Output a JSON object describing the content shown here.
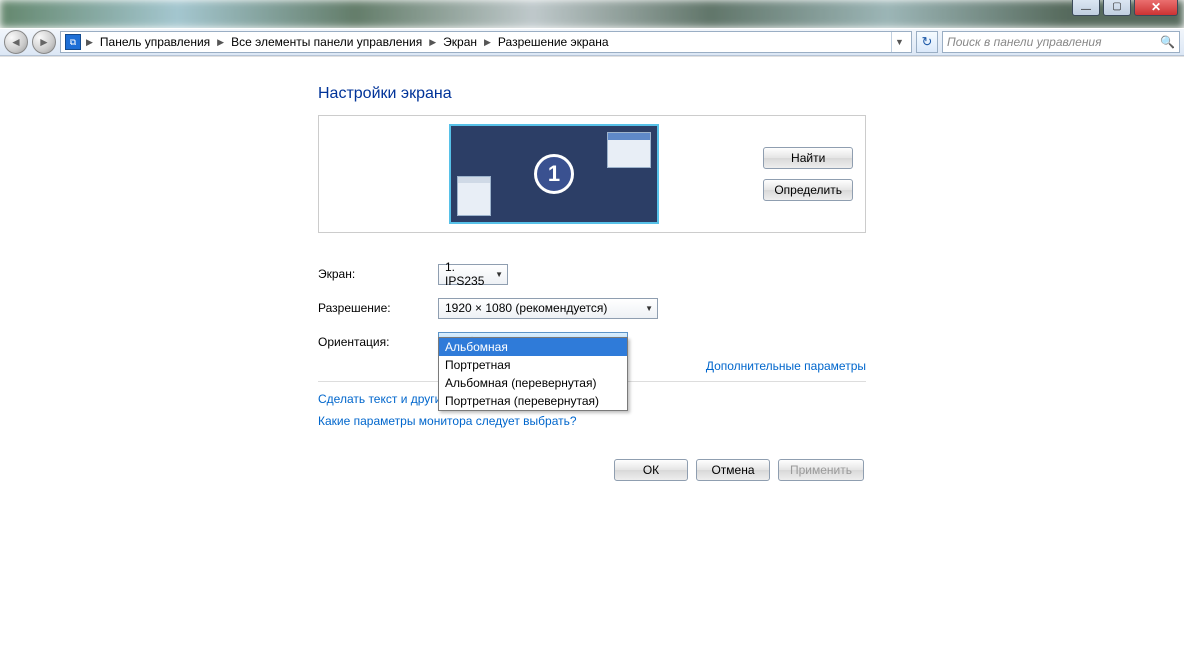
{
  "window_controls": {
    "min": "—",
    "max": "▢",
    "close": "✕"
  },
  "breadcrumb": {
    "items": [
      "Панель управления",
      "Все элементы панели управления",
      "Экран",
      "Разрешение экрана"
    ]
  },
  "search": {
    "placeholder": "Поиск в панели управления"
  },
  "page": {
    "title": "Настройки экрана",
    "monitor_number": "1",
    "find_btn": "Найти",
    "detect_btn": "Определить",
    "screen_label": "Экран:",
    "screen_value": "1. IPS235",
    "resolution_label": "Разрешение:",
    "resolution_value": "1920 × 1080 (рекомендуется)",
    "orientation_label": "Ориентация:",
    "orientation_value": "Альбомная",
    "orientation_options": [
      "Альбомная",
      "Портретная",
      "Альбомная (перевернутая)",
      "Портретная (перевернутая)"
    ],
    "advanced_link": "Дополнительные параметры",
    "help1": "Сделать текст и другие",
    "help2": "Какие параметры монитора следует выбрать?",
    "ok": "ОК",
    "cancel": "Отмена",
    "apply": "Применить"
  }
}
